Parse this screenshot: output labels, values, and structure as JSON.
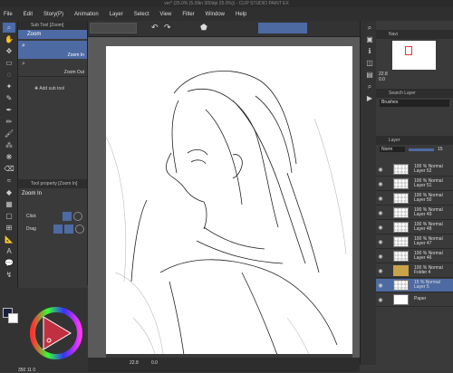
{
  "window": {
    "title": "ver* (25.0% (5.09in 300dpi 25.0%)) - CLIP STUDIO PAINT EX"
  },
  "menu": [
    "File",
    "Edit",
    "Story(P)",
    "Animation",
    "Layer",
    "Select",
    "View",
    "Filter",
    "Window",
    "Help"
  ],
  "sub_tool": {
    "header": "Sub Tool [Zoom]",
    "items": [
      {
        "label": "Zoom In"
      },
      {
        "label": "Zoom Out"
      }
    ],
    "group_label": "Zoom",
    "add_label": "Add sub tool"
  },
  "tool_property": {
    "header": "Tool property [Zoom In]",
    "title": "Zoom In",
    "click_label": "Click",
    "drag_label": "Drag"
  },
  "canvas": {
    "zoom": "22.8",
    "angle": "0.0"
  },
  "navigator": {
    "header": "Navi",
    "zoom": "22.8",
    "angle": "0.0"
  },
  "search_layer": {
    "header": "Search Layer",
    "blend": "Brushes"
  },
  "layer": {
    "header": "Layer",
    "blend": "Norm",
    "opacity": "15",
    "rows": [
      {
        "line1": "100 % Normal",
        "line2": "Layer 52"
      },
      {
        "line1": "100 % Normal",
        "line2": "Layer 51"
      },
      {
        "line1": "100 % Normal",
        "line2": "Layer 50"
      },
      {
        "line1": "100 % Normal",
        "line2": "Layer 49"
      },
      {
        "line1": "100 % Normal",
        "line2": "Layer 48"
      },
      {
        "line1": "100 % Normal",
        "line2": "Layer 47"
      },
      {
        "line1": "100 % Normal",
        "line2": "Layer 46"
      },
      {
        "line1": "100 % Normal",
        "line2": "Folder 4"
      },
      {
        "line1": "15 % Normal",
        "line2": "Layer 5"
      },
      {
        "line1": "",
        "line2": "Paper"
      }
    ]
  },
  "color": {
    "main": "#1a1f3c",
    "sub": "#ffffff",
    "selected": "#b03040"
  },
  "status": {
    "zoom": "350",
    "value": "11",
    "value2": "0"
  }
}
